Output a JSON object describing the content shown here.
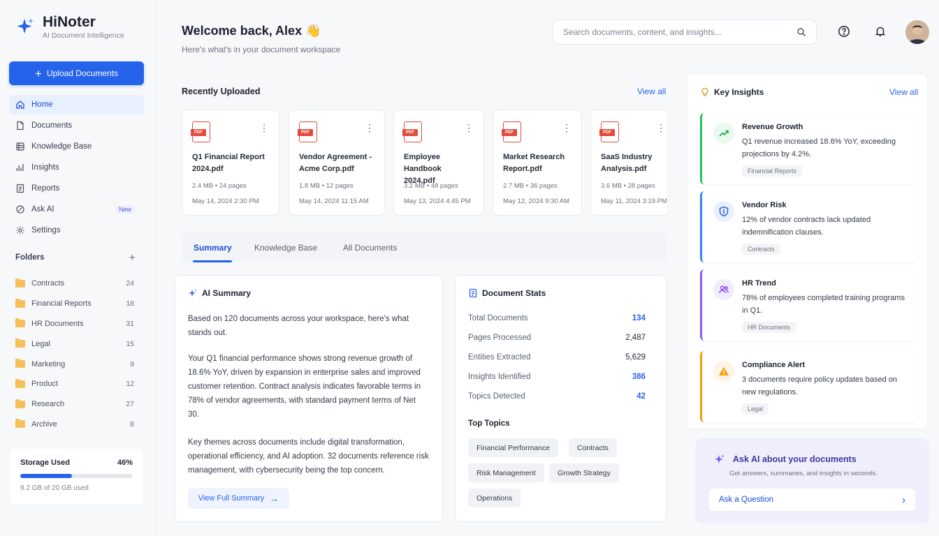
{
  "brand": {
    "name": "HiNoter",
    "tagline": "AI Document Intelligence"
  },
  "sidebar": {
    "upload_label": "Upload Documents",
    "nav": [
      {
        "label": "Home",
        "icon": "home-icon",
        "active": true
      },
      {
        "label": "Documents",
        "icon": "document-icon"
      },
      {
        "label": "Knowledge Base",
        "icon": "database-icon"
      },
      {
        "label": "Insights",
        "icon": "insights-icon"
      },
      {
        "label": "Reports",
        "icon": "report-icon"
      },
      {
        "label": "Ask AI",
        "icon": "ask-ai-icon",
        "badge": "New"
      },
      {
        "label": "Settings",
        "icon": "gear-icon"
      }
    ],
    "folders_title": "Folders",
    "folders": [
      {
        "name": "Contracts",
        "count": "24"
      },
      {
        "name": "Financial Reports",
        "count": "18"
      },
      {
        "name": "HR Documents",
        "count": "31"
      },
      {
        "name": "Legal",
        "count": "15"
      },
      {
        "name": "Marketing",
        "count": "9"
      },
      {
        "name": "Product",
        "count": "12"
      },
      {
        "name": "Research",
        "count": "27"
      },
      {
        "name": "Archive",
        "count": "8"
      }
    ],
    "storage": {
      "label": "Storage Used",
      "percent_label": "46%",
      "percent": 46,
      "detail": "9.2 GB of 20 GB used"
    }
  },
  "header": {
    "welcome": "Welcome back, Alex 👋",
    "subtitle": "Here's what's in your document workspace",
    "search_placeholder": "Search documents, content, and insights..."
  },
  "recent": {
    "title": "Recently Uploaded",
    "view_all": "View all",
    "docs": [
      {
        "name": "Q1 Financial Report 2024.pdf",
        "meta": "2.4 MB • 24 pages",
        "date": "May 14, 2024   2:30 PM"
      },
      {
        "name": "Vendor Agreement - Acme Corp.pdf",
        "meta": "1.8 MB • 12 pages",
        "date": "May 14, 2024   11:15 AM"
      },
      {
        "name": "Employee Handbook 2024.pdf",
        "meta": "3.2 MB • 48 pages",
        "date": "May 13, 2024   4:45 PM"
      },
      {
        "name": "Market Research Report.pdf",
        "meta": "2.7 MB • 36 pages",
        "date": "May 12, 2024   9:30 AM"
      },
      {
        "name": "SaaS Industry Analysis.pdf",
        "meta": "3.6 MB • 28 pages",
        "date": "May 11, 2024   3:19 PM"
      }
    ]
  },
  "tabs": [
    "Summary",
    "Knowledge Base",
    "All Documents"
  ],
  "summary": {
    "title": "AI Summary",
    "p1": "Based on 120 documents across your workspace, here's what stands out.",
    "p2": "Your Q1 financial performance shows strong revenue growth of 18.6% YoY, driven by expansion in enterprise sales and improved customer retention. Contract analysis indicates favorable terms in 78% of vendor agreements, with standard payment terms of Net 30.",
    "p3": "Key themes across documents include digital transformation, operational efficiency, and AI adoption. 32 documents reference risk management, with cybersecurity being the top concern.",
    "button": "View Full Summary"
  },
  "stats": {
    "title": "Document Stats",
    "rows": [
      {
        "label": "Total Documents",
        "value": "134"
      },
      {
        "label": "Pages Processed",
        "value": "2,487"
      },
      {
        "label": "Entities Extracted",
        "value": "5,629"
      },
      {
        "label": "Insights Identified",
        "value": "386"
      },
      {
        "label": "Topics Detected",
        "value": "42"
      }
    ],
    "topics_title": "Top Topics",
    "topics": [
      "Financial Performance",
      "Contracts",
      "Risk Management",
      "Growth Strategy",
      "Operations"
    ]
  },
  "insights": {
    "title": "Key Insights",
    "view_all": "View all",
    "items": [
      {
        "title": "Revenue Growth",
        "body": "Q1 revenue increased 18.6% YoY, exceeding projections by 4.2%.",
        "tag": "Financial Reports",
        "color": "#22c55e",
        "icon": "trend-up-icon"
      },
      {
        "title": "Vendor Risk",
        "body": "12% of vendor contracts lack updated indemnification clauses.",
        "tag": "Contracts",
        "color": "#3b82f6",
        "icon": "shield-icon"
      },
      {
        "title": "HR Trend",
        "body": "78% of employees completed training programs in Q1.",
        "tag": "HR Documents",
        "color": "#8b5cf6",
        "icon": "users-icon"
      },
      {
        "title": "Compliance Alert",
        "body": "3 documents require policy updates based on new regulations.",
        "tag": "Legal",
        "color": "#f59e0b",
        "icon": "warning-icon"
      }
    ]
  },
  "ask_ai": {
    "title": "Ask AI about your documents",
    "subtitle": "Get answers, summaries, and insights in seconds.",
    "button": "Ask a Question"
  },
  "colors": {
    "accent": "#2563eb",
    "sidebar_bg": "#f7f8fa"
  }
}
